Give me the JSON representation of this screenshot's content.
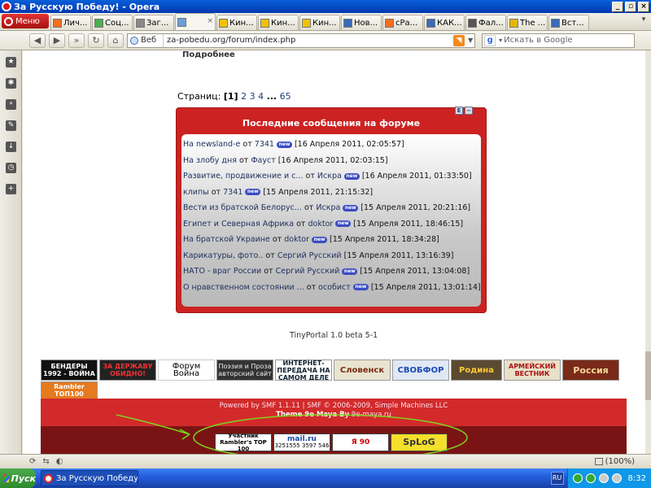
{
  "window": {
    "title": "За Русскую Победу! - Opera"
  },
  "tabbar": {
    "menu_label": "Меню",
    "tabs": [
      {
        "label": "Лич...",
        "color": "#f36f21"
      },
      {
        "label": "Соц...",
        "color": "#4caf50"
      },
      {
        "label": "Заг...",
        "color": "#888888"
      },
      {
        "label": "",
        "color": "#6aa0d8"
      },
      {
        "label": "Кин...",
        "color": "#f2c200"
      },
      {
        "label": "Кин...",
        "color": "#f2c200"
      },
      {
        "label": "Кин...",
        "color": "#f2c200"
      },
      {
        "label": "Нов...",
        "color": "#3a6bb8"
      },
      {
        "label": "сPа...",
        "color": "#f36f21"
      },
      {
        "label": "КАК...",
        "color": "#3a6bb8"
      },
      {
        "label": "Фал...",
        "color": "#555555"
      },
      {
        "label": "The ...",
        "color": "#e8b400"
      },
      {
        "label": "Вст...",
        "color": "#3a6bb8"
      }
    ]
  },
  "addressbar": {
    "web_label": "Веб",
    "url": "za-pobedu.org/forum/index.php",
    "search_placeholder": "Искать в Google"
  },
  "page": {
    "more_label": "Подробнее",
    "pagination": {
      "label": "Страниц:",
      "current": "[1]",
      "links": [
        "2",
        "3",
        "4"
      ],
      "ellipsis": "...",
      "last": "65"
    },
    "recent": {
      "title": "Последние сообщения на форуме",
      "new_badge": "new",
      "posts": [
        {
          "title": "На newsland-е",
          "from": "от",
          "author": "7341",
          "has_new": true,
          "date": "[16 Апреля 2011, 02:05:57]"
        },
        {
          "title": "На злобу дня",
          "from": "от",
          "author": "Фауст",
          "has_new": false,
          "date": "[16 Апреля 2011, 02:03:15]"
        },
        {
          "title": "Развитие, продвижение и с...",
          "from": "от",
          "author": "Искра",
          "has_new": true,
          "date": "[16 Апреля 2011, 01:33:50]"
        },
        {
          "title": "клипы",
          "from": "от",
          "author": "7341",
          "has_new": true,
          "date": "[15 Апреля 2011, 21:15:32]"
        },
        {
          "title": "Вести из братской Белорус...",
          "from": "от",
          "author": "Искра",
          "has_new": true,
          "date": "[15 Апреля 2011, 20:21:16]"
        },
        {
          "title": "Египет и Северная Африка",
          "from": "от",
          "author": "doktor",
          "has_new": true,
          "date": "[15 Апреля 2011, 18:46:15]"
        },
        {
          "title": "На братской Украине",
          "from": "от",
          "author": "doktor",
          "has_new": true,
          "date": "[15 Апреля 2011, 18:34:28]"
        },
        {
          "title": "Карикатуры, фото..",
          "from": "от",
          "author": "Сергий Русский",
          "has_new": false,
          "date": "[15 Апреля 2011, 13:16:39]"
        },
        {
          "title": "НАТО - враг России",
          "from": "от",
          "author": "Сергий Русский",
          "has_new": true,
          "date": "[15 Апреля 2011, 13:04:08]"
        },
        {
          "title": "О нравственном состоянии ...",
          "from": "от",
          "author": "особист",
          "has_new": true,
          "date": "[15 Апреля 2011, 13:01:14]"
        }
      ]
    },
    "tinyportal": "TinyPortal 1.0 beta 5-1",
    "banners": [
      {
        "text": "БЕНДЕРЫ 1992 - ВОЙНА"
      },
      {
        "text": "ЗА ДЕРЖАВУ ОБИДНО!"
      },
      {
        "text": "Форум Война"
      },
      {
        "text": "Поэзия и Проза авторский сайт"
      },
      {
        "text": "ИНТЕРНЕТ-ПЕРЕДАЧА НА САМОМ ДЕЛЕ"
      },
      {
        "text": "Словенск"
      },
      {
        "text": "СВОБФОР"
      },
      {
        "text": "Родина"
      },
      {
        "text": "АРМЕЙСКИЙ ВЕСТНИК"
      },
      {
        "text": "Россия"
      },
      {
        "text": "Rambler ТОП100"
      }
    ],
    "footer": {
      "powered": "Powered by SMF 1.1.11 | SMF © 2006-2009, Simple Machines LLC",
      "theme_prefix": "Theme 9e Maya By",
      "theme_link": "9e-maya.ru",
      "counters": {
        "rambler": "Участник Rambler's TOP 100",
        "mailru": "mail.ru",
        "mailru_num1": "3597",
        "mailru_num2": "3251555",
        "mailru_num3": "546",
        "yandex": "Я 90",
        "splog": "SpLoG"
      }
    }
  },
  "statusbar": {
    "zoom": "(100%)"
  },
  "taskbar": {
    "start_label": "Пуск",
    "active_task": "За Русскую Победу!...",
    "lang": "RU",
    "clock": "8:32"
  }
}
